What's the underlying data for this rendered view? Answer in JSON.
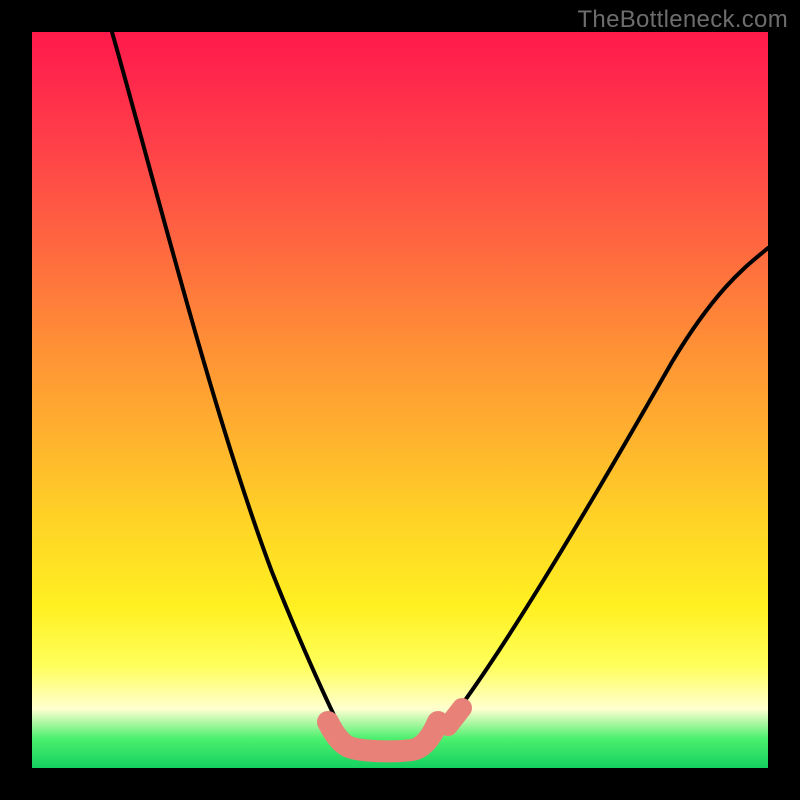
{
  "watermark": "TheBottleneck.com",
  "chart_data": {
    "type": "line",
    "title": "",
    "xlabel": "",
    "ylabel": "",
    "xlim": [
      0,
      100
    ],
    "ylim": [
      0,
      100
    ],
    "series": [
      {
        "name": "left-curve",
        "x": [
          11,
          14,
          17,
          20,
          23,
          26,
          29,
          32,
          35,
          37,
          39,
          41,
          43
        ],
        "y": [
          100,
          92,
          82,
          72,
          62,
          52,
          42,
          32,
          22,
          14,
          9,
          5,
          3
        ]
      },
      {
        "name": "right-curve",
        "x": [
          55,
          58,
          62,
          66,
          70,
          75,
          80,
          85,
          90,
          95,
          100
        ],
        "y": [
          4,
          8,
          14,
          20,
          27,
          35,
          43,
          51,
          58,
          65,
          71
        ]
      },
      {
        "name": "valley-marker",
        "x": [
          40,
          42,
          44,
          46,
          48,
          50,
          52,
          54,
          55
        ],
        "y": [
          6,
          4,
          3,
          3,
          3,
          3,
          3,
          4,
          6
        ]
      }
    ],
    "gradient_stops": [
      {
        "pos": 0,
        "color": "#ff1a4b"
      },
      {
        "pos": 17,
        "color": "#ff4548"
      },
      {
        "pos": 42,
        "color": "#ff8e36"
      },
      {
        "pos": 66,
        "color": "#ffd226"
      },
      {
        "pos": 86,
        "color": "#ffff5a"
      },
      {
        "pos": 96,
        "color": "#4cf06e"
      },
      {
        "pos": 100,
        "color": "#14d060"
      }
    ]
  }
}
